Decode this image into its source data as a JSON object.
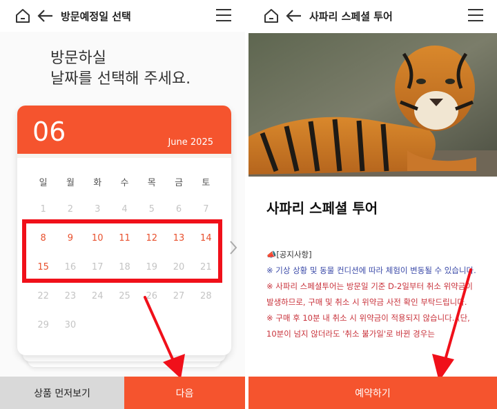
{
  "left": {
    "header": {
      "title": "방문예정일 선택"
    },
    "intro": {
      "line1": "방문하실",
      "line2": "날짜를 선택해 주세요."
    },
    "calendar": {
      "month": "06",
      "month_year": "June 2025",
      "weekdays": [
        "일",
        "월",
        "화",
        "수",
        "목",
        "금",
        "토"
      ],
      "weeks": [
        [
          "1",
          "2",
          "3",
          "4",
          "5",
          "6",
          "7"
        ],
        [
          "8",
          "9",
          "10",
          "11",
          "12",
          "13",
          "14"
        ],
        [
          "15",
          "16",
          "17",
          "18",
          "19",
          "20",
          "21"
        ],
        [
          "22",
          "23",
          "24",
          "25",
          "26",
          "27",
          "28"
        ],
        [
          "29",
          "30",
          "",
          "",
          "",
          "",
          ""
        ]
      ],
      "available_days": [
        "8",
        "9",
        "10",
        "11",
        "12",
        "13",
        "14",
        "15"
      ]
    },
    "buttons": {
      "preview": "상품 먼저보기",
      "next": "다음"
    }
  },
  "right": {
    "header": {
      "title": "사파리 스페셜 투어"
    },
    "product_title": "사파리 스페셜 투어",
    "notice": {
      "head": "📣[공지사항]",
      "lines": [
        {
          "text": "※ 기상 상황 및 동물 컨디션에 따라 체험이 변동될 수 있습니다.",
          "color": "blue"
        },
        {
          "text": "※ 사파리 스페셜투어는 방문일 기준 D-2일부터 취소 위약금이 발생하므로, 구매 및 취소 시 위약금 사전 확인 부탁드립니다.",
          "color": "red"
        },
        {
          "text": "※ 구매 후 10분 내 취소 시 위약금이 적용되지 않습니다. (단, 10분이 넘지 않더라도 '취소 불가일'로 바뀐 경우는",
          "color": "red"
        }
      ]
    },
    "buttons": {
      "reserve": "예약하기"
    }
  },
  "colors": {
    "accent": "#f5542e",
    "highlight": "#f0101a",
    "blue_text": "#3b4aa8",
    "red_text": "#c8313a"
  },
  "icons": [
    "home-icon",
    "back-arrow-icon",
    "hamburger-menu-icon",
    "chevron-right-icon",
    "megaphone-icon"
  ]
}
